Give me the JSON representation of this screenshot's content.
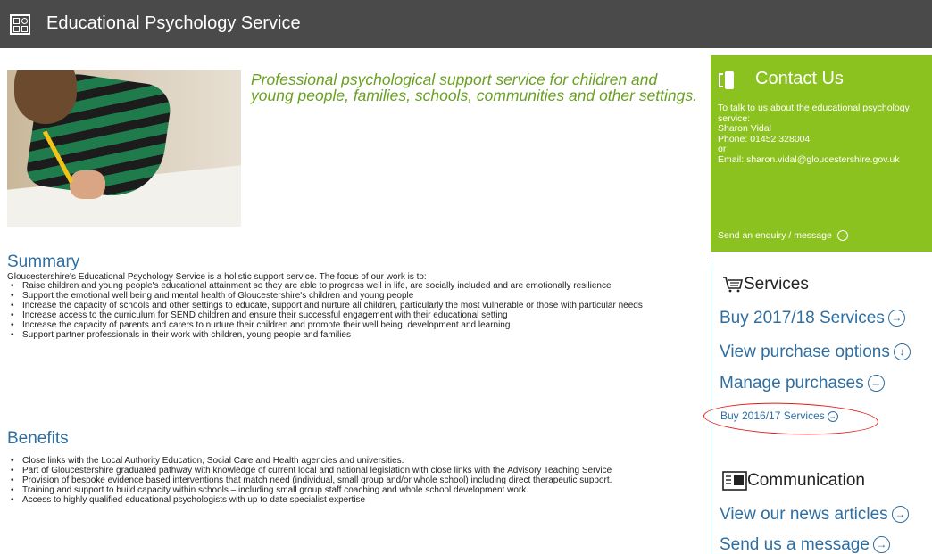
{
  "header": {
    "title": "Educational Psychology Service",
    "logo_icon": "grid-symbols-icon"
  },
  "hero": {
    "image_icon": "child-writing-photo",
    "tagline": "Professional psychological support service for children and young people, families, schools, communities and other settings."
  },
  "summary": {
    "heading": "Summary",
    "intro": "Gloucestershire's Educational Psychology Service is a holistic support service. The focus of our work is to:",
    "items": [
      "Raise children and young people's educational attainment so they are able to progress well in life, are socially included and are emotionally resilience",
      "Support the emotional well being and mental health of Gloucestershire's children and young people",
      "Increase the capacity of schools and other settings to educate, support and nurture all children, particularly the most vulnerable or those with particular needs",
      "Increase access to the curriculum for SEND children and ensure their successful engagement with their educational setting",
      "Increase the capacity of parents and carers to nurture their children and promote their well being, development and learning",
      "Support partner professionals in their work with children, young people and families"
    ]
  },
  "benefits": {
    "heading": "Benefits",
    "items": [
      "Close links with the Local Authority Education, Social Care and Health agencies and universities.",
      "Part of Gloucestershire graduated pathway with knowledge of current local and national legislation with close links with the Advisory Teaching Service",
      "Provision of bespoke evidence based interventions that match need (individual, small group and/or whole school) including direct therapeutic support.",
      "Training and support to build capacity within schools – including small group staff coaching and whole school development work.",
      "Access to highly qualified educational psychologists with up to date specialist expertise"
    ]
  },
  "contact": {
    "title": "Contact Us",
    "line1": "To talk to us about the educational psychology",
    "line2": "service:",
    "name": "Sharon Vidal",
    "phone": "Phone: 01452 328004",
    "or": "or",
    "email": "Email: sharon.vidal@gloucestershire.gov.uk",
    "link": "Send an enquiry / message",
    "color": "#8cc21f"
  },
  "services": {
    "heading": "Services",
    "links": [
      {
        "label": "Buy 2017/18 Services"
      },
      {
        "label": "View purchase options"
      },
      {
        "label": "Manage purchases"
      }
    ],
    "small_link": "Buy 2016/17 Services"
  },
  "communication": {
    "heading": "Communication",
    "links": [
      {
        "label": "View our news articles"
      },
      {
        "label": "Send us a message"
      }
    ]
  },
  "colors": {
    "header_bg": "#4a4a4a",
    "link_blue": "#2f6ea0",
    "tagline_green": "#6aa121",
    "annotation_red": "#e31b1b"
  }
}
